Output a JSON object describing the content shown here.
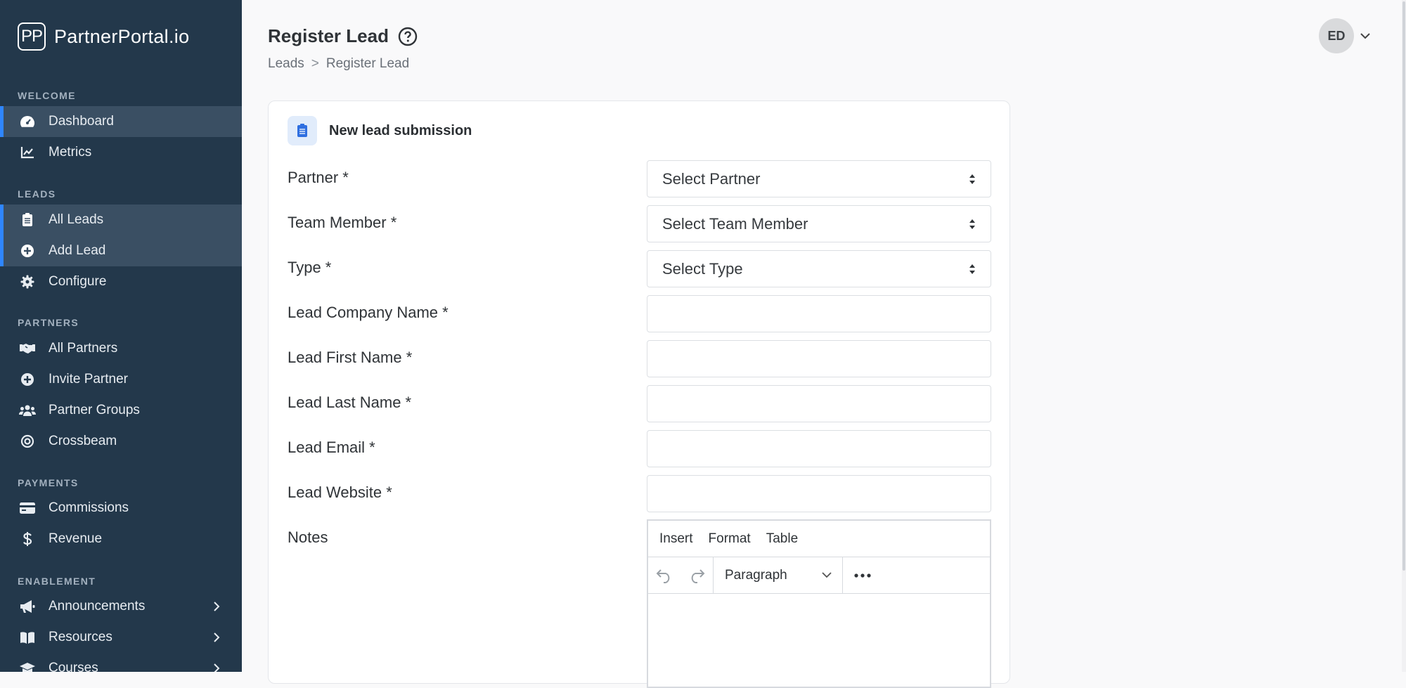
{
  "brand": {
    "logo": "PP",
    "name": "PartnerPortal.io"
  },
  "sidebar": {
    "sections": [
      {
        "label": "WELCOME"
      },
      {
        "label": "LEADS"
      },
      {
        "label": "PARTNERS"
      },
      {
        "label": "PAYMENTS"
      },
      {
        "label": "ENABLEMENT"
      }
    ],
    "items": [
      {
        "label": "Dashboard",
        "icon": "gauge-icon"
      },
      {
        "label": "Metrics",
        "icon": "chart-line-icon"
      },
      {
        "label": "All Leads",
        "icon": "clipboard-list-icon"
      },
      {
        "label": "Add Lead",
        "icon": "plus-circle-icon"
      },
      {
        "label": "Configure",
        "icon": "gear-icon"
      },
      {
        "label": "All Partners",
        "icon": "handshake-icon"
      },
      {
        "label": "Invite Partner",
        "icon": "plus-circle-icon"
      },
      {
        "label": "Partner Groups",
        "icon": "users-icon"
      },
      {
        "label": "Crossbeam",
        "icon": "target-icon"
      },
      {
        "label": "Commissions",
        "icon": "credit-card-icon"
      },
      {
        "label": "Revenue",
        "icon": "dollar-icon"
      },
      {
        "label": "Announcements",
        "icon": "megaphone-icon"
      },
      {
        "label": "Resources",
        "icon": "book-icon"
      },
      {
        "label": "Courses",
        "icon": "graduation-cap-icon"
      }
    ]
  },
  "header": {
    "title": "Register Lead",
    "breadcrumb": {
      "parent": "Leads",
      "separator": ">",
      "current": "Register Lead"
    },
    "avatar_initials": "ED"
  },
  "card": {
    "title": "New lead submission",
    "fields": [
      {
        "label": "Partner *",
        "type": "select",
        "value": "Select Partner"
      },
      {
        "label": "Team Member *",
        "type": "select",
        "value": "Select Team Member"
      },
      {
        "label": "Type *",
        "type": "select",
        "value": "Select Type"
      },
      {
        "label": "Lead Company Name *",
        "type": "text",
        "value": ""
      },
      {
        "label": "Lead First Name *",
        "type": "text",
        "value": ""
      },
      {
        "label": "Lead Last Name *",
        "type": "text",
        "value": ""
      },
      {
        "label": "Lead Email *",
        "type": "text",
        "value": ""
      },
      {
        "label": "Lead Website *",
        "type": "text",
        "value": ""
      }
    ],
    "notes": {
      "label": "Notes",
      "menubar": [
        "Insert",
        "Format",
        "Table"
      ],
      "block_format": "Paragraph"
    }
  },
  "colors": {
    "sidebar_bg": "#23384b",
    "active_bg": "#3a4f63",
    "accent": "#2f86ff",
    "page_bg": "#f9f9fa"
  }
}
